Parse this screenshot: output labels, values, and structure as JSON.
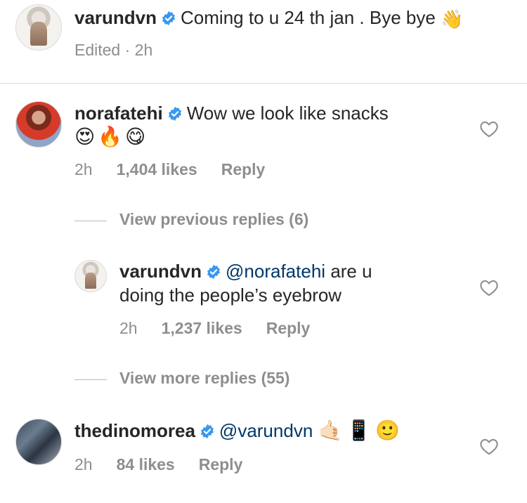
{
  "caption": {
    "username": "varundvn",
    "text": "Coming to u 24 th jan . Bye bye",
    "emoji": "👋",
    "meta": "Edited · 2h"
  },
  "comments": [
    {
      "username": "norafatehi",
      "text": "Wow we look like snacks",
      "emojis": "😍🔥😋",
      "time": "2h",
      "likes": "1,404 likes",
      "reply_label": "Reply"
    }
  ],
  "view_previous": "View previous replies (6)",
  "reply": {
    "username": "varundvn",
    "mention": "@norafatehi",
    "text_line1": "are u",
    "text_line2": "doing the people’s eyebrow",
    "time": "2h",
    "likes": "1,237 likes",
    "reply_label": "Reply"
  },
  "view_more": "View more replies (55)",
  "comment2": {
    "username": "thedinomorea",
    "mention": "@varundvn",
    "emojis": "🤙🏻📱🙂",
    "time": "2h",
    "likes": "84 likes",
    "reply_label": "Reply"
  },
  "icons": {
    "verified": "verified-badge-icon",
    "like": "heart-outline-icon"
  },
  "colors": {
    "verified_blue": "#3897f0",
    "mention_blue": "#00376b",
    "meta_gray": "#8e8e8e"
  }
}
